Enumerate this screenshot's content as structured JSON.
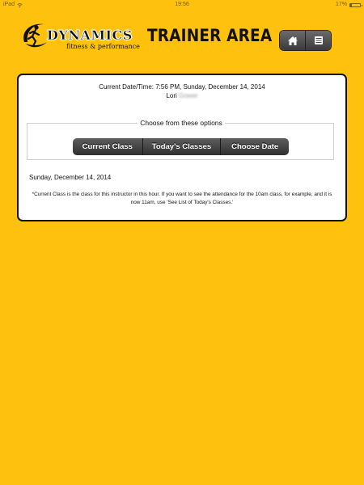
{
  "status_bar": {
    "device": "iPad",
    "time": "19:56",
    "battery": "17%",
    "battery_level": 0.17
  },
  "header": {
    "logo_icon": "running-figure-swoosh-icon",
    "logo_brand": "DYNAMICS",
    "logo_tagline": "fitness & performance",
    "title": "TRAINER AREA",
    "home_icon": "home-icon",
    "menu_icon": "list-menu-icon"
  },
  "card": {
    "datetime": "Current Date/Time: 7:56 PM, Sunday, December 14, 2014",
    "user_first": "Lori",
    "user_last": "Gower",
    "options_legend": "Choose from these options",
    "buttons": {
      "current_class": "Current Class",
      "todays_classes": "Today's Classes",
      "choose_date": "Choose Date"
    },
    "selected_date": "Sunday, December 14, 2014",
    "note": "*Current Class is the class for this instructor in this hour. If you want to see the attendance for the 10am class, for example, and it is now 11am, use 'See List of Today's Classes.'"
  },
  "colors": {
    "background": "#FDC10E",
    "button_dark": "#3a3a3a",
    "card": "#FFFFFF"
  }
}
